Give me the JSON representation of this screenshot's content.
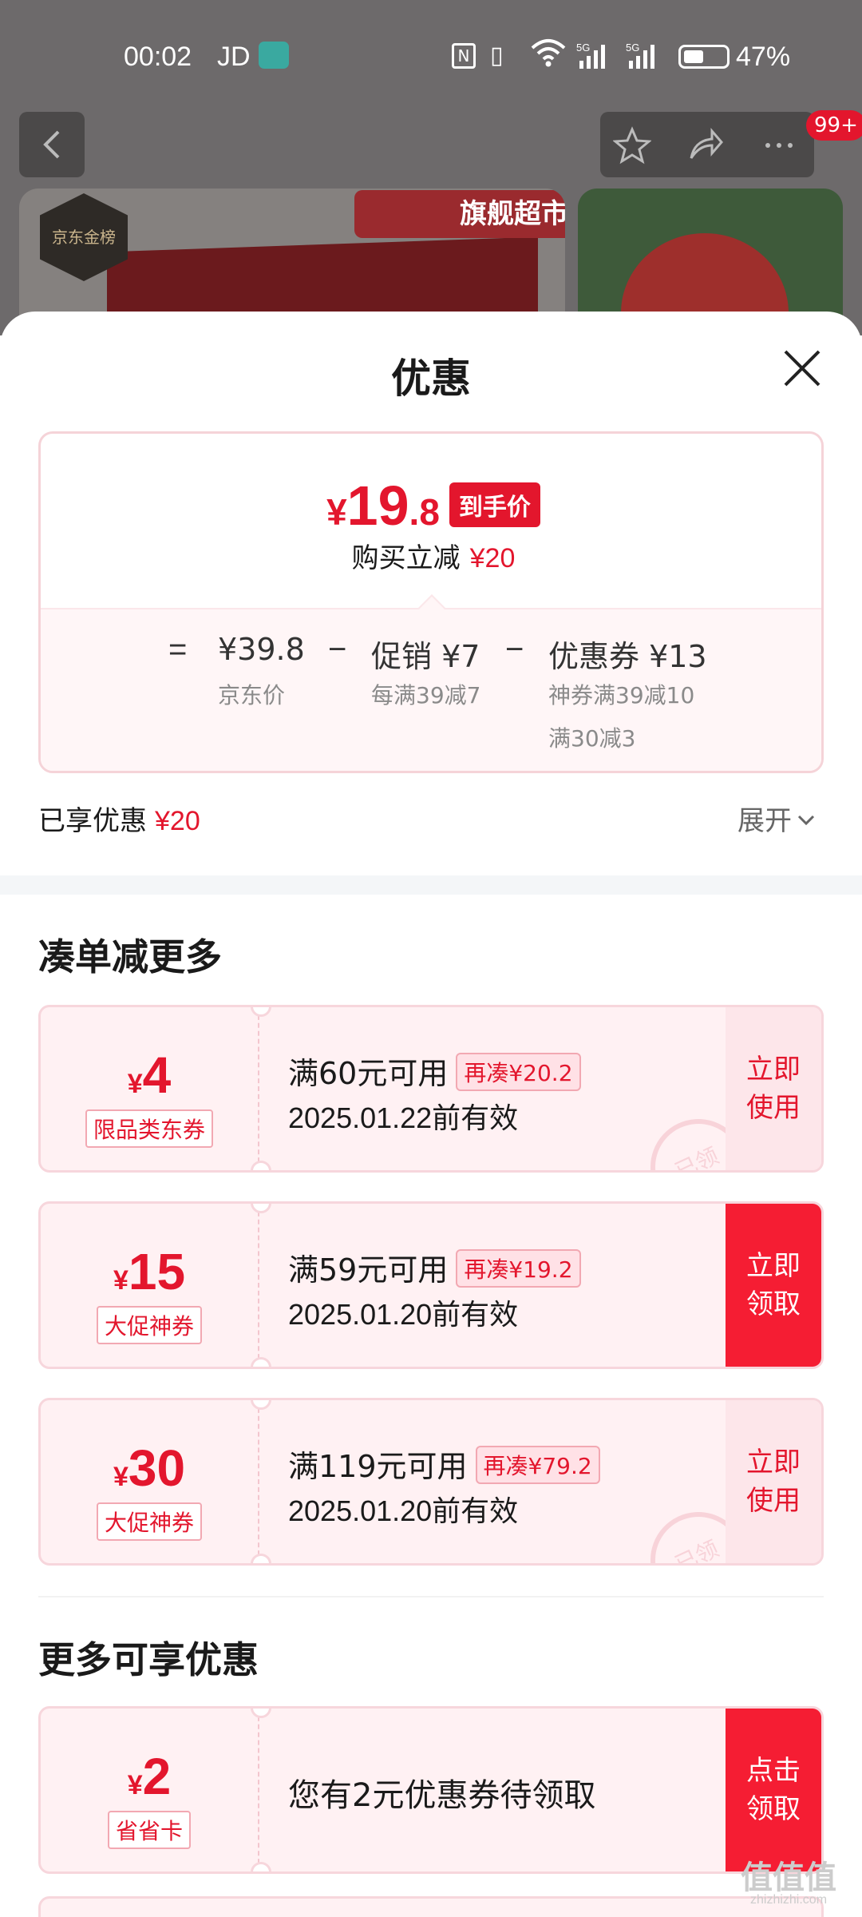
{
  "status_bar": {
    "time": "00:02",
    "carrier": "JD",
    "battery": "47%"
  },
  "header": {
    "badge": "99+",
    "flagship_tag": "旗舰超市",
    "gold_badge": "京东金榜"
  },
  "sheet": {
    "title": "优惠",
    "price_card": {
      "currency": "¥",
      "price_int": "19",
      "price_dec": ".8",
      "final_tag": "到手价",
      "save_label": "购买立减",
      "save_amount": "¥20",
      "breakdown": {
        "eq": "=",
        "minus1": "−",
        "minus2": "−",
        "jd_price": "¥39.8",
        "jd_price_label": "京东价",
        "promo": "促销 ¥7",
        "promo_desc": "每满39减7",
        "coupon": "优惠券 ¥13",
        "coupon_desc1": "神券满39减10",
        "coupon_desc2": "满30减3"
      }
    },
    "enjoyed_label": "已享优惠",
    "enjoyed_amount": "¥20",
    "expand_label": "展开",
    "section_more_title": "凑单减更多",
    "coupons": [
      {
        "currency": "¥",
        "amount": "4",
        "type": "限品类东券",
        "condition": "满60元可用",
        "more": "再凑¥20.2",
        "valid": "2025.01.22前有效",
        "action": "立即使用",
        "stamp": "已领"
      },
      {
        "currency": "¥",
        "amount": "15",
        "type": "大促神券",
        "condition": "满59元可用",
        "more": "再凑¥19.2",
        "valid": "2025.01.20前有效",
        "action": "立即领取"
      },
      {
        "currency": "¥",
        "amount": "30",
        "type": "大促神券",
        "condition": "满119元可用",
        "more": "再凑¥79.2",
        "valid": "2025.01.20前有效",
        "action": "立即使用",
        "stamp": "已领"
      }
    ],
    "section_extra_title": "更多可享优惠",
    "extra_coupon": {
      "currency": "¥",
      "amount": "2",
      "type": "省省卡",
      "text": "您有2元优惠券待领取",
      "action": "点击领取"
    }
  },
  "watermark": {
    "text": "值值值",
    "sub": "zhizhizhi.com"
  },
  "colors": {
    "accent": "#e3162d",
    "coupon_bg": "#fff1f3",
    "solid_action": "#f51d33"
  }
}
